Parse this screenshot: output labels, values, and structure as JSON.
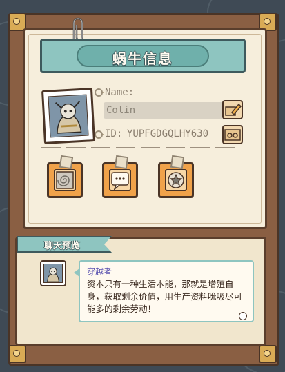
{
  "header": {
    "title": "蜗牛信息"
  },
  "profile": {
    "name_label": "Name:",
    "name_value": "Colin",
    "id_label": "ID:",
    "id_value": "YUPFGDGQLHY630"
  },
  "actions": [
    {
      "icon": "swirl-icon"
    },
    {
      "icon": "chat-icon"
    },
    {
      "icon": "star-badge-icon"
    }
  ],
  "chat_preview": {
    "tab_label": "聊天预览",
    "sender": "穿越者",
    "message": "资本只有一种生活本能，那就是增殖自身，获取剩余价值，用生产资料吮吸尽可能多的剩余劳动！"
  },
  "colors": {
    "accent_teal": "#8ec5c0",
    "frame_brown": "#8a5f43",
    "action_orange": "#f0a24a",
    "sender_purple": "#5a52b0"
  }
}
